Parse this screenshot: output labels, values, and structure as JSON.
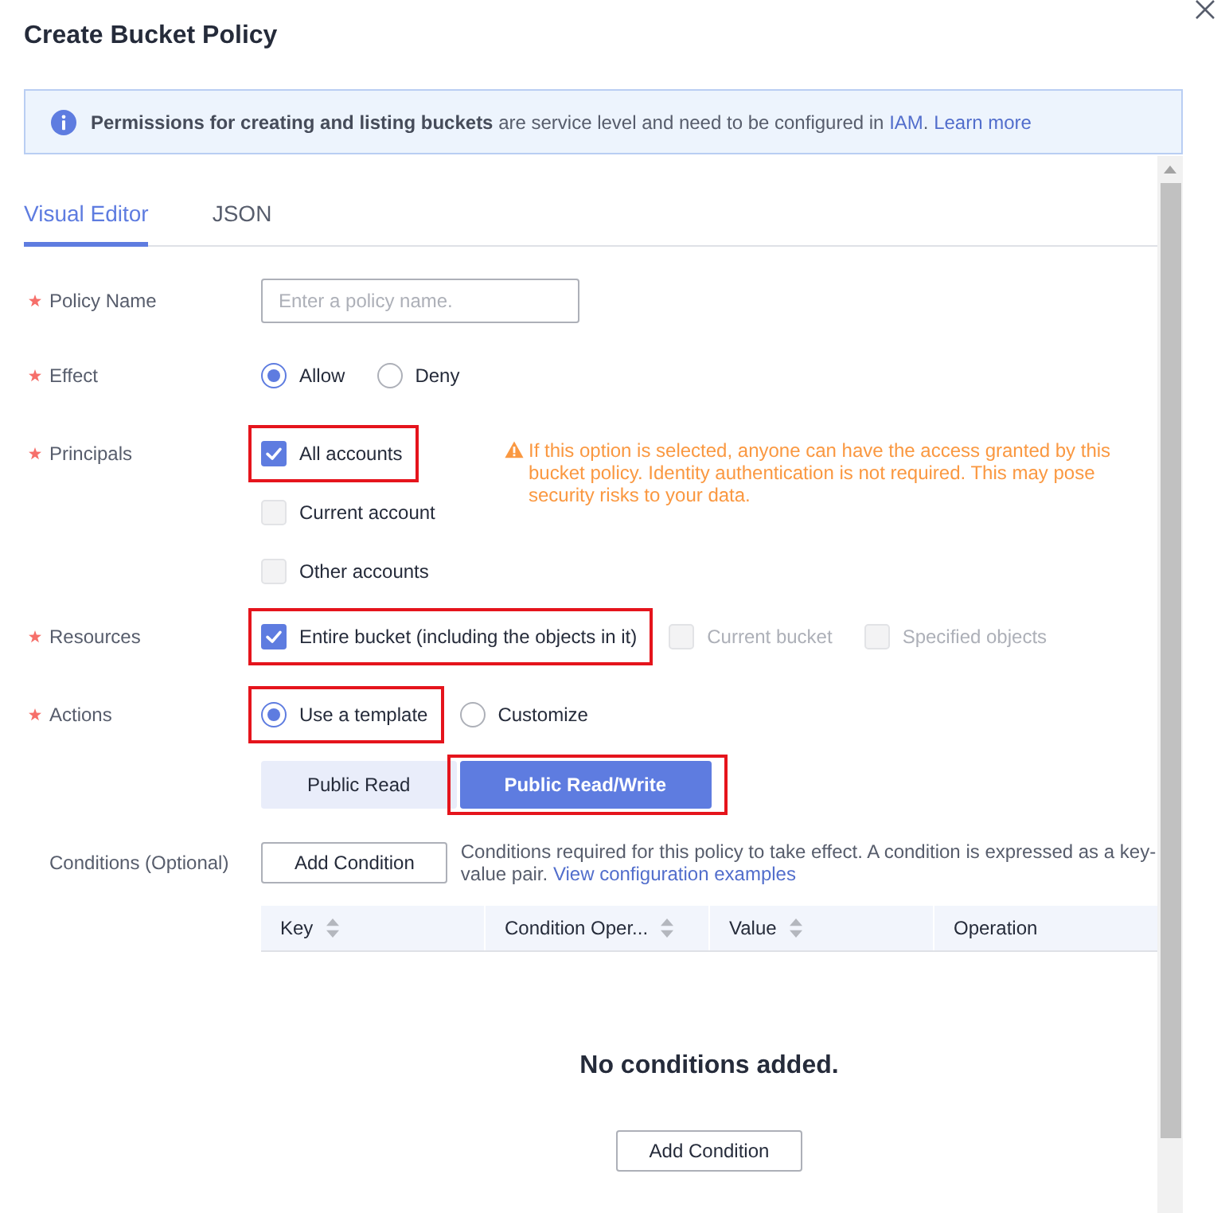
{
  "dialog": {
    "title": "Create Bucket Policy"
  },
  "notice": {
    "segments": [
      {
        "kind": "text",
        "text": "**Permissions for creating and listing buckets** are service level and need to be configured in "
      },
      {
        "kind": "link",
        "text": "IAM"
      },
      {
        "kind": "text",
        "text": ". "
      },
      {
        "kind": "link",
        "text": "Learn more"
      }
    ]
  },
  "tabs": [
    {
      "label": "Visual Editor",
      "selected": true
    },
    {
      "label": "JSON",
      "selected": false
    }
  ],
  "policy_name": {
    "label": "Policy Name",
    "required": true,
    "placeholder": "Enter a policy name."
  },
  "effect": {
    "label": "Effect",
    "required": true,
    "options": [
      {
        "label": "Allow",
        "selected": true
      },
      {
        "label": "Deny",
        "selected": false
      }
    ]
  },
  "principals": {
    "label": "Principals",
    "required": true,
    "options": [
      {
        "label": "All accounts",
        "checked": true,
        "highlighted": true
      },
      {
        "label": "Current account",
        "checked": false,
        "highlighted": false
      },
      {
        "label": "Other accounts",
        "checked": false,
        "highlighted": false
      }
    ],
    "warning": "If this option is selected, anyone can have the access granted by this bucket policy. Identity authentication is not required. This may pose security risks to your data."
  },
  "resources": {
    "label": "Resources",
    "required": true,
    "options": [
      {
        "label": "Entire bucket (including the objects in it)",
        "checked": true,
        "disabled": false,
        "highlighted": true
      },
      {
        "label": "Current bucket",
        "checked": false,
        "disabled": true,
        "highlighted": false
      },
      {
        "label": "Specified objects",
        "checked": false,
        "disabled": true,
        "highlighted": false
      }
    ]
  },
  "actions": {
    "label": "Actions",
    "required": true,
    "options": [
      {
        "label": "Use a template",
        "selected": true,
        "highlighted": true
      },
      {
        "label": "Customize",
        "selected": false,
        "highlighted": false
      }
    ],
    "templates": [
      {
        "label": "Public Read",
        "selected": false,
        "highlighted": false
      },
      {
        "label": "Public Read/Write",
        "selected": true,
        "highlighted": true
      }
    ]
  },
  "conditions": {
    "label": "Conditions (Optional)",
    "required": false,
    "button": "Add Condition",
    "description": [
      {
        "kind": "text",
        "text": "Conditions required for this policy to take effect. A condition is expressed as a key-value pair. "
      },
      {
        "kind": "link",
        "text": "View configuration examples"
      }
    ],
    "table": {
      "columns": [
        {
          "label": "Key",
          "sortable": true
        },
        {
          "label": "Condition Oper...",
          "sortable": true
        },
        {
          "label": "Value",
          "sortable": true
        },
        {
          "label": "Operation",
          "sortable": false
        }
      ],
      "empty_message": "No conditions added.",
      "empty_button": "Add Condition"
    }
  }
}
